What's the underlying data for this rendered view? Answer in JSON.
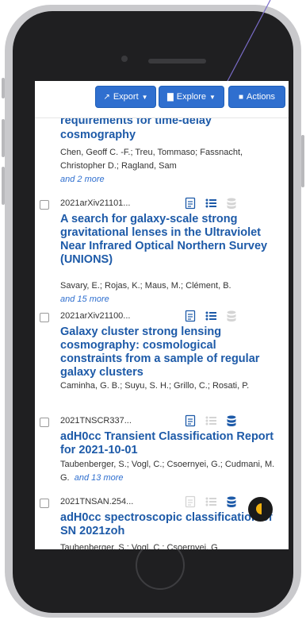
{
  "toolbar": {
    "export_label": "Export",
    "explore_label": "Explore",
    "actions_label": "Actions"
  },
  "results": [
    {
      "bibcode": "",
      "title_partial": "requirements for time-delay",
      "title": "cosmography",
      "authors": "Chen, Geoff C. -F.; Treu, Tommaso; Fassnacht, Christopher D.; Ragland, Sam",
      "more": "and 2 more"
    },
    {
      "bibcode": "2021arXiv21101...",
      "title": "A search for galaxy-scale strong gravitational lenses in the Ultraviolet Near Infrared Optical Northern Survey (UNIONS)",
      "authors": "Savary, E.; Rojas, K.; Maus, M.; Clément, B.",
      "more": "and 15 more"
    },
    {
      "bibcode": "2021arXiv21100...",
      "title": "Galaxy cluster strong lensing cosmography: cosmological constraints from a sample of regular galaxy clusters",
      "authors": "Caminha, G. B.; Suyu, S. H.; Grillo, C.; Rosati, P.",
      "more": ""
    },
    {
      "bibcode": "2021TNSCR337...",
      "title": "adH0cc Transient Classification Report for 2021-10-01",
      "authors": "Taubenberger, S.; Vogl, C.; Csoernyei, G.; Cudmani, M. G.",
      "more": "and 13 more"
    },
    {
      "bibcode": "2021TNSAN.254...",
      "title": "adH0cc spectroscopic classification of SN 2021zoh",
      "authors": "Taubenberger, S.; Vogl, C.; Csoernyei, G.",
      "more": ""
    }
  ],
  "colors": {
    "accent": "#2f6fcf",
    "title": "#1d5aa8",
    "icon_active": "#1d5aa8",
    "icon_inactive": "#d4d4d4"
  }
}
